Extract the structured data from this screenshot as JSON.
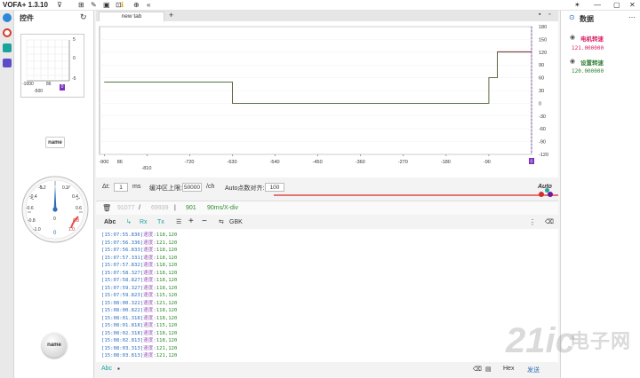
{
  "window": {
    "title": "VOFA+ 1.3.10",
    "controls": {
      "pin": "✶",
      "minimize": "—",
      "maximize": "▢",
      "close": "✕"
    }
  },
  "toolbar_icons": [
    "plugin-icon",
    "grid-icon",
    "wrench-icon",
    "screenshot-icon",
    "frame-icon",
    "info-icon",
    "globe-icon",
    "collapse-icon"
  ],
  "panel": {
    "title": "控件",
    "refresh_icon": "↻",
    "xy_plot": {
      "y_ticks": [
        "5",
        "0",
        "-5"
      ],
      "x_ticks": [
        "-1000",
        "86",
        "-500"
      ],
      "badge": "0"
    },
    "name_button_1": "name",
    "dial": {
      "ticks_left": [
        "-0.2",
        "-0.4",
        "-0.6",
        "-0.8",
        "-1.0"
      ],
      "ticks_right": [
        "0.2",
        "0.4",
        "0.6",
        "0.8",
        "1.0"
      ],
      "center": "0",
      "value": "0"
    },
    "name_button_2": "name"
  },
  "tabs": [
    {
      "label": "new tab"
    }
  ],
  "add_tab": "+",
  "plot": {
    "y_ticks": [
      "180",
      "150",
      "120",
      "90",
      "60",
      "30",
      "0",
      "-30",
      "-60",
      "-90",
      "-120"
    ],
    "x_ticks": [
      "-900",
      "-810",
      "-720",
      "-630",
      "-540",
      "-450",
      "-360",
      "-270",
      "-180",
      "-90"
    ],
    "x_extra": "86",
    "badge_x": "0",
    "badge_y": "0",
    "chart_data": {
      "type": "line",
      "series": [
        {
          "name": "电机转速",
          "x": [
            -900,
            -630,
            -630,
            -90,
            -90,
            -72,
            -72,
            0
          ],
          "y": [
            50,
            50,
            0,
            0,
            60,
            60,
            121,
            121
          ],
          "color": "#c2185b"
        },
        {
          "name": "设置转速",
          "x": [
            -900,
            -630,
            -630,
            -90,
            -90,
            -72,
            -72,
            0
          ],
          "y": [
            50,
            50,
            0,
            0,
            60,
            60,
            120,
            120
          ],
          "color": "#2e7d32"
        }
      ],
      "xlim": [
        -910,
        0
      ],
      "ylim": [
        -120,
        180
      ]
    }
  },
  "controls": {
    "dt_label": "Δt:",
    "dt_value": "1",
    "dt_unit": "ms",
    "buffer_label": "缓冲区上限:",
    "buffer_value": "50000",
    "buffer_unit": "/ch",
    "auto_label": "Auto点数对齐:",
    "auto_value": "100",
    "auto_text": "Auto"
  },
  "toolbar2": {
    "sample_count": "91077",
    "sep1": "/",
    "total": "69939",
    "sep2": "|",
    "points": "901",
    "xdiv": "90ms/X-div"
  },
  "toolbar3": {
    "abc": "Abc",
    "rx": "Rx",
    "tx": "Tx",
    "plus": "+",
    "minus": "−",
    "encoding": "GBK",
    "more": "⋮"
  },
  "log": [
    {
      "ts": "[15:07:55.836]",
      "label": "速度:",
      "value": "118,120"
    },
    {
      "ts": "[15:07:56.336]",
      "label": "速度:",
      "value": "121,120"
    },
    {
      "ts": "[15:07:56.833]",
      "label": "速度:",
      "value": "118,120"
    },
    {
      "ts": "[15:07:57.331]",
      "label": "速度:",
      "value": "118,120"
    },
    {
      "ts": "[15:07:57.832]",
      "label": "速度:",
      "value": "118,120"
    },
    {
      "ts": "[15:07:58.327]",
      "label": "速度:",
      "value": "118,120"
    },
    {
      "ts": "[15:07:58.827]",
      "label": "速度:",
      "value": "118,120"
    },
    {
      "ts": "[15:07:59.327]",
      "label": "速度:",
      "value": "118,120"
    },
    {
      "ts": "[15:07:59.823]",
      "label": "速度:",
      "value": "115,120"
    },
    {
      "ts": "[15:08:00.322]",
      "label": "速度:",
      "value": "121,120"
    },
    {
      "ts": "[15:08:00.822]",
      "label": "速度:",
      "value": "118,120"
    },
    {
      "ts": "[15:08:01.318]",
      "label": "速度:",
      "value": "118,120"
    },
    {
      "ts": "[15:08:01.818]",
      "label": "速度:",
      "value": "115,120"
    },
    {
      "ts": "[15:08:02.318]",
      "label": "速度:",
      "value": "118,120"
    },
    {
      "ts": "[15:08:02.813]",
      "label": "速度:",
      "value": "118,120"
    },
    {
      "ts": "[15:08:03.313]",
      "label": "速度:",
      "value": "121,120"
    },
    {
      "ts": "[15:08:03.813]",
      "label": "速度:",
      "value": "121,120"
    }
  ],
  "statusbar": {
    "abc": "Abc",
    "mode": "Hex",
    "sent": "发送"
  },
  "rpanel": {
    "title": "数据",
    "more": "⋯",
    "channels": [
      {
        "name": "电机转速",
        "value": "121.000000",
        "color": "#d81b60"
      },
      {
        "name": "设置转速",
        "value": "120.000000",
        "color": "#2e7d32"
      }
    ]
  },
  "watermark": {
    "brand": "21ic",
    "cn": "电子网"
  }
}
